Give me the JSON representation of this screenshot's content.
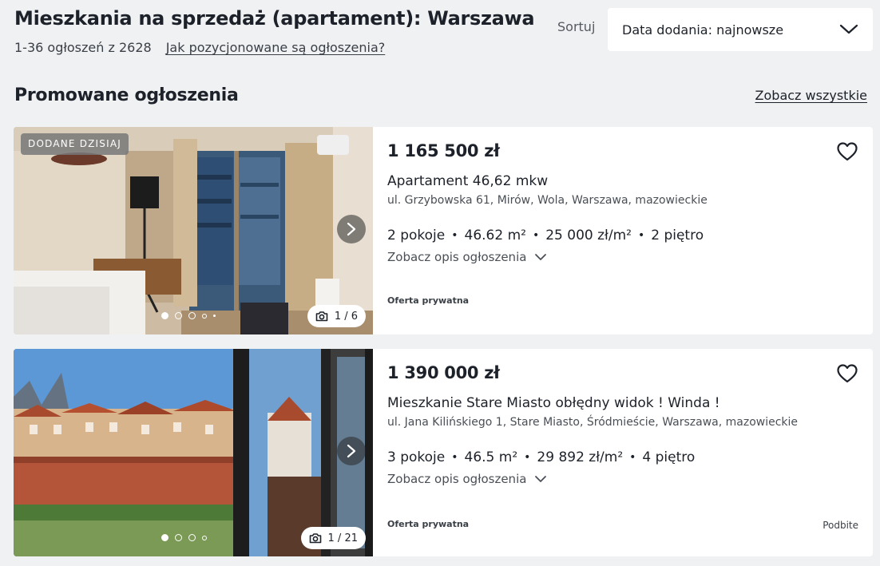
{
  "header": {
    "title": "Mieszkania na sprzedaż (apartament): Warszawa",
    "results": "1-36 ogłoszeń z 2628",
    "ranking_link": "Jak pozycjonowane są ogłoszenia?",
    "sort_label": "Sortuj",
    "sort_value": "Data dodania: najnowsze"
  },
  "section": {
    "title": "Promowane ogłoszenia",
    "see_all": "Zobacz wszystkie"
  },
  "listings": [
    {
      "tag": "DODANE DZISIAJ",
      "photo_counter": "1 / 6",
      "price": "1 165 500 zł",
      "title": "Apartament 46,62 mkw",
      "address": "ul. Grzybowska 61, Mirów, Wola, Warszawa, mazowieckie",
      "rooms": "2 pokoje",
      "area": "46.62 m²",
      "price_per_m": "25 000 zł/m²",
      "floor": "2 piętro",
      "description_link": "Zobacz opis ogłoszenia",
      "offer_type": "Oferta prywatna"
    },
    {
      "photo_counter": "1 / 21",
      "price": "1 390 000 zł",
      "title": "Mieszkanie Stare Miasto obłędny widok ! Winda !",
      "address": "ul. Jana Kilińskiego 1, Stare Miasto, Śródmieście, Warszawa, mazowieckie",
      "rooms": "3 pokoje",
      "area": "46.5 m²",
      "price_per_m": "29 892 zł/m²",
      "floor": "4 piętro",
      "description_link": "Zobacz opis ogłoszenia",
      "offer_type": "Oferta prywatna",
      "bumped": "Podbite"
    }
  ],
  "icons": [
    "chevron-down-icon",
    "chevron-right-icon",
    "camera-icon",
    "heart-icon"
  ],
  "colors": {
    "background": "#f0f1f3",
    "card": "#ffffff",
    "text": "#1d2129"
  }
}
